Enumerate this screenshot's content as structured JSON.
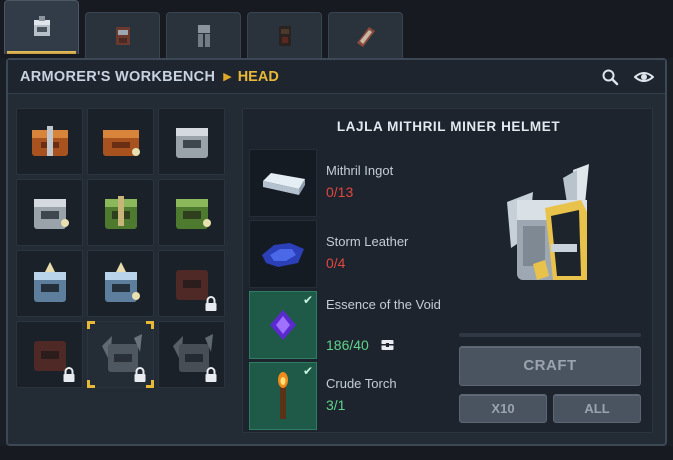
{
  "tabs": [
    {
      "icon": "armor-helmet-icon",
      "active": true
    },
    {
      "icon": "chest-armor-icon",
      "active": false
    },
    {
      "icon": "leg-armor-icon",
      "active": false
    },
    {
      "icon": "dark-armor-icon",
      "active": false
    },
    {
      "icon": "bracers-icon",
      "active": false
    }
  ],
  "header": {
    "title": "ARMORER'S WORKBENCH",
    "separator": "▶",
    "subtitle": "HEAD",
    "search_icon": "search-icon",
    "view_icon": "eye-icon"
  },
  "grid": [
    {
      "icon": "copper-helmet-icon",
      "locked": false,
      "selected": false
    },
    {
      "icon": "copper-miner-helmet-icon",
      "locked": false,
      "selected": false
    },
    {
      "icon": "iron-helmet-icon",
      "locked": false,
      "selected": false
    },
    {
      "icon": "iron-miner-helmet-icon",
      "locked": false,
      "selected": false
    },
    {
      "icon": "scarlet-helmet-icon",
      "locked": false,
      "selected": false
    },
    {
      "icon": "scarlet-miner-helmet-icon",
      "locked": false,
      "selected": false
    },
    {
      "icon": "octarine-helmet-icon",
      "locked": false,
      "selected": false
    },
    {
      "icon": "octarine-miner-helmet-icon",
      "locked": false,
      "selected": false
    },
    {
      "icon": "locked-helmet-icon",
      "locked": true,
      "selected": false
    },
    {
      "icon": "locked-helmet-icon",
      "locked": true,
      "selected": false
    },
    {
      "icon": "mithril-winged-helmet-icon",
      "locked": true,
      "selected": true
    },
    {
      "icon": "mithril-winged-helmet-icon",
      "locked": true,
      "selected": false
    }
  ],
  "detail": {
    "item_name": "LAJLA MITHRIL MINER HELMET",
    "ingredients": [
      {
        "name": "Mithril Ingot",
        "count": "0/13",
        "ok": false,
        "icon": "mithril-ingot-icon"
      },
      {
        "name": "Storm Leather",
        "count": "0/4",
        "ok": false,
        "icon": "storm-leather-icon"
      },
      {
        "name": "Essence of the Void",
        "count": "186/40",
        "ok": true,
        "icon": "void-essence-icon",
        "from_chest": true
      },
      {
        "name": "Crude Torch",
        "count": "3/1",
        "ok": true,
        "icon": "torch-icon"
      }
    ],
    "craft_label": "CRAFT",
    "x10_label": "X10",
    "all_label": "ALL",
    "craft_progress": 0
  },
  "colors": {
    "accent": "#e8b838",
    "bad": "#e0473f",
    "good": "#5fd38a",
    "ok_slot": "#1f5a48"
  }
}
